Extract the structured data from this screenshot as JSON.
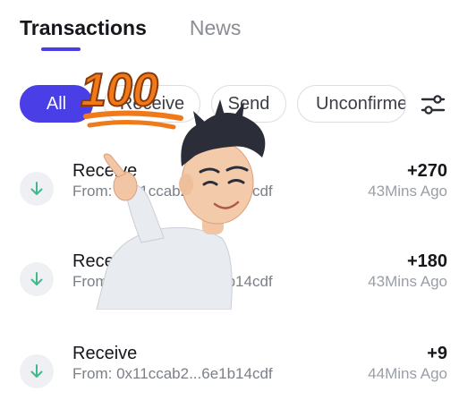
{
  "tabs": [
    {
      "label": "Transactions",
      "active": true
    },
    {
      "label": "News",
      "active": false
    }
  ],
  "filters": {
    "all": "All",
    "receive": "Receive",
    "send": "Send",
    "unconfirmed": "Unconfirmed"
  },
  "sticker_text": "100",
  "transactions": [
    {
      "title": "Receive",
      "from": "From: 0x11ccab2...6e1b14cdf",
      "amount": "+270",
      "time": "43Mins Ago"
    },
    {
      "title": "Receive",
      "from": "From: 0x11ccab2...6e1b14cdf",
      "amount": "+180",
      "time": "43Mins Ago"
    },
    {
      "title": "Receive",
      "from": "From: 0x11ccab2...6e1b14cdf",
      "amount": "+9",
      "time": "44Mins Ago"
    }
  ],
  "colors": {
    "accent": "#4a3ee6",
    "receive_arrow": "#3fb98a",
    "sticker_orange": "#f07a1a"
  },
  "icons": {
    "filter": "sliders-icon",
    "receive": "arrow-down-icon"
  }
}
